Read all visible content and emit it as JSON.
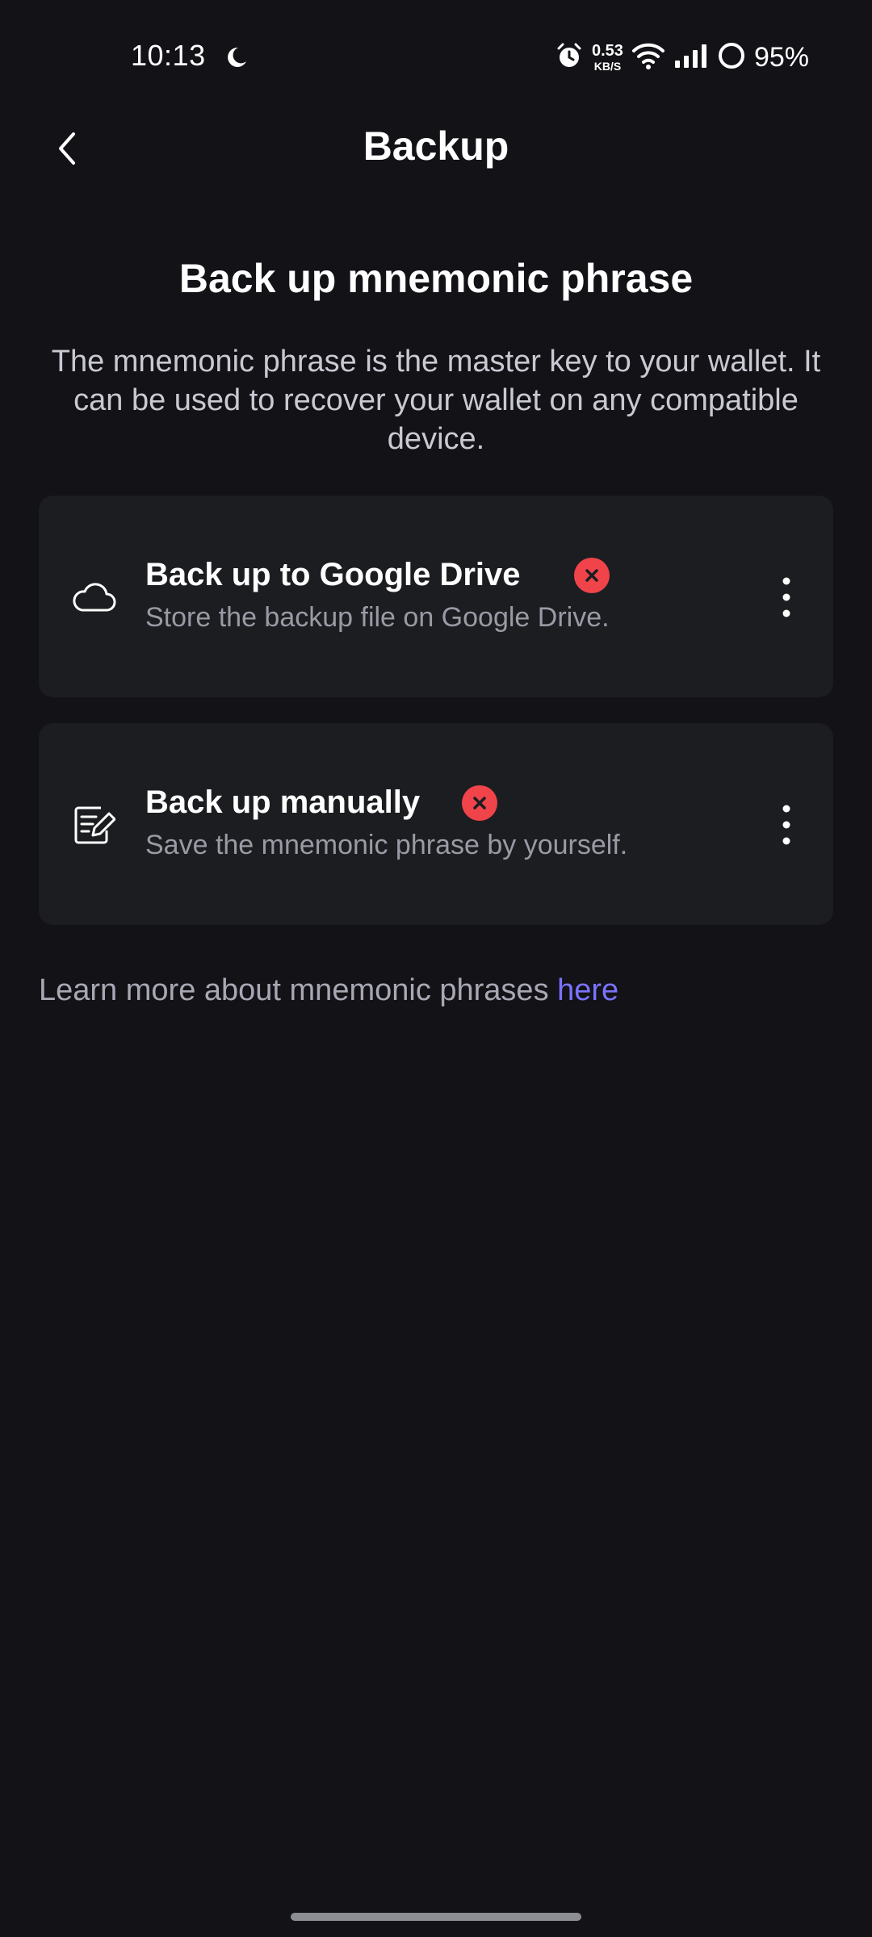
{
  "status_bar": {
    "time": "10:13",
    "net_speed_value": "0.53",
    "net_speed_unit": "KB/S",
    "battery": "95%"
  },
  "header": {
    "title": "Backup"
  },
  "section": {
    "heading": "Back up mnemonic phrase",
    "description": "The mnemonic phrase is the master key to your wallet. It can be used to recover your wallet on any compatible device."
  },
  "options": [
    {
      "title": "Back up to Google Drive",
      "subtitle": "Store the backup file on Google Drive.",
      "icon": "cloud-icon",
      "status": "not-backed-up"
    },
    {
      "title": "Back up manually",
      "subtitle": "Save the mnemonic phrase by yourself.",
      "icon": "edit-note-icon",
      "status": "not-backed-up"
    }
  ],
  "footer": {
    "learn_more_text": "Learn more about mnemonic phrases ",
    "learn_more_link": "here"
  },
  "colors": {
    "background": "#121217",
    "card": "#1c1d21",
    "error": "#f0444a",
    "link": "#7a73ff"
  }
}
